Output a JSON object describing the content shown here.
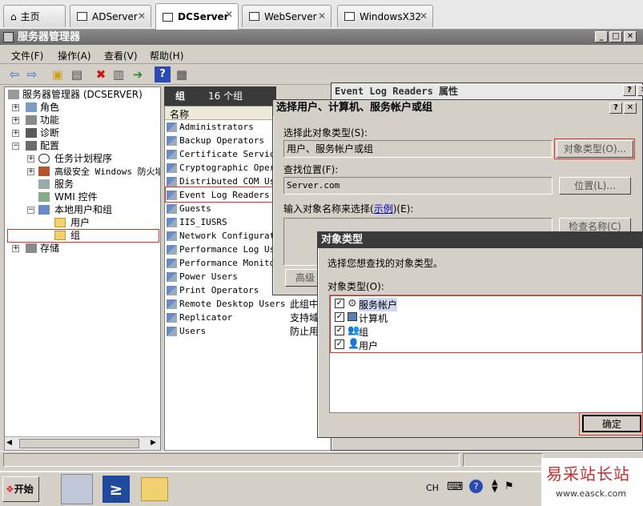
{
  "vm_tabs": [
    {
      "label": "主页"
    },
    {
      "label": "ADServer"
    },
    {
      "label": "DCServer"
    },
    {
      "label": "WebServer"
    },
    {
      "label": "WindowsX32"
    }
  ],
  "window": {
    "title": "服务器管理器"
  },
  "menu": [
    "文件(F)",
    "操作(A)",
    "查看(V)",
    "帮助(H)"
  ],
  "tree": {
    "root": "服务器管理器 (DCSERVER)",
    "items": [
      "角色",
      "功能",
      "诊断",
      "配置",
      "任务计划程序",
      "高级安全 Windows 防火墙",
      "服务",
      "WMI 控件",
      "本地用户和组",
      "用户",
      "组",
      "存储"
    ]
  },
  "groups_pane": {
    "header": "组",
    "count": "16 个组",
    "column_name": "名称",
    "rows": [
      "Administrators",
      "Backup Operators",
      "Certificate Servic...",
      "Cryptographic Oper...",
      "Distributed COM Use...",
      "Event Log Readers",
      "Guests",
      "IIS_IUSRS",
      "Network Configurat...",
      "Performance Log Use...",
      "Performance Monito...",
      "Power Users",
      "Print Operators",
      "Remote Desktop Users",
      "Replicator",
      "Users"
    ],
    "desc_fragments": [
      "此组中",
      "支持域",
      "防止用"
    ]
  },
  "props_dialog": {
    "title": "Event Log Readers 属性"
  },
  "select_dialog": {
    "title": "选择用户、计算机、服务帐户或组",
    "obj_type_label": "选择此对象类型(S):",
    "obj_type_value": "用户、服务帐户或组",
    "obj_type_button": "对象类型(O)...",
    "location_label": "查找位置(F):",
    "location_value": "Server.com",
    "location_button": "位置(L)...",
    "enter_prefix": "输入对象名称来选择(",
    "enter_link": "示例",
    "enter_suffix": ")(E):",
    "check_names_button": "检查名称(C)",
    "advanced_button": "高级"
  },
  "objtype_dialog": {
    "title": "对象类型",
    "prompt": "选择您想查找的对象类型。",
    "list_label": "对象类型(O):",
    "items": [
      {
        "label": "服务帐户",
        "checked": true
      },
      {
        "label": "计算机",
        "checked": true
      },
      {
        "label": "组",
        "checked": true
      },
      {
        "label": "用户",
        "checked": true
      }
    ],
    "ok_button": "确定"
  },
  "taskbar": {
    "start": "开始",
    "lang": "CH"
  },
  "watermark": {
    "text": "易采站长站",
    "url": "www.easck.com"
  },
  "colors": {
    "highlight": "#d32f2f",
    "title_dark": "#3a3a3a",
    "link": "#0000cc"
  }
}
